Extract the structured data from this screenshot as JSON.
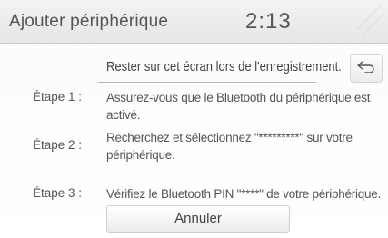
{
  "header": {
    "title": "Ajouter périphérique",
    "clock": "2:13"
  },
  "stay_option": {
    "label": "Rester sur cet écran lors de l'enregistrement."
  },
  "steps": [
    {
      "label": "Étape 1 :",
      "text": "Assurez-vous que le Bluetooth du périphérique est activé."
    },
    {
      "label": "Étape 2 :",
      "text": "Recherchez et sélectionnez \"*********\" sur votre périphérique."
    },
    {
      "label": "Étape 3 :",
      "text": "Vérifiez le Bluetooth PIN \"****\" de votre périphérique."
    }
  ],
  "buttons": {
    "cancel": "Annuler",
    "back_icon": "return-arrow-icon"
  }
}
